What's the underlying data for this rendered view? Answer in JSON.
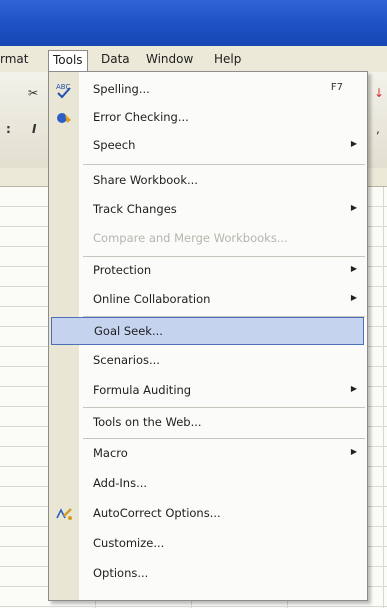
{
  "menubar": {
    "items": [
      "rmat",
      "Tools",
      "Data",
      "Window",
      "Help"
    ]
  },
  "toolbar": {
    "cut_glyph": "✂",
    "italic_glyph": "I"
  },
  "tools_menu": {
    "items": [
      {
        "label": "Spelling...",
        "shortcut": "F7",
        "icon": "spelling-icon"
      },
      {
        "label": "Error Checking...",
        "icon": "error-checking-icon"
      },
      {
        "label": "Speech",
        "submenu": true
      },
      {
        "label": "Share Workbook..."
      },
      {
        "label": "Track Changes",
        "submenu": true
      },
      {
        "label": "Compare and Merge Workbooks...",
        "disabled": true
      },
      {
        "label": "Protection",
        "submenu": true
      },
      {
        "label": "Online Collaboration",
        "submenu": true
      },
      {
        "label": "Goal Seek...",
        "highlighted": true
      },
      {
        "label": "Scenarios..."
      },
      {
        "label": "Formula Auditing",
        "submenu": true
      },
      {
        "label": "Tools on the Web..."
      },
      {
        "label": "Macro",
        "submenu": true
      },
      {
        "label": "Add-Ins..."
      },
      {
        "label": "AutoCorrect Options...",
        "icon": "autocorrect-icon"
      },
      {
        "label": "Customize..."
      },
      {
        "label": "Options..."
      }
    ]
  },
  "colors": {
    "titlebar": "#2f63d6",
    "menu_highlight": "#c6d3ef",
    "highlight_border": "#4b6fb8"
  }
}
